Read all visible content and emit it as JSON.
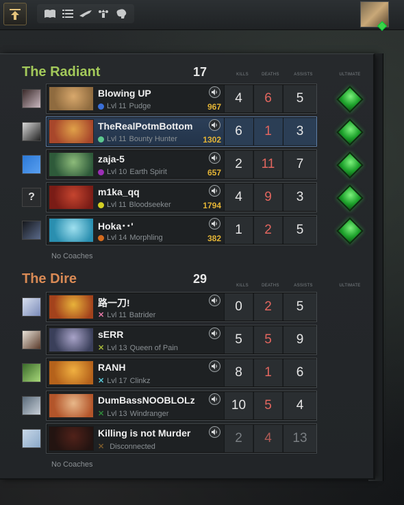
{
  "colors": {
    "radiant": "#a3c95a",
    "dire": "#d98a55",
    "deaths": "#e2665f",
    "gold": "#e3b436",
    "ultimate": "#3cd24a"
  },
  "topbar": {
    "main_button_icon": "up-arrow-icon",
    "icons": [
      "book-icon",
      "list-icon",
      "courier-icon",
      "share-icon",
      "brain-icon"
    ],
    "avatar": "player-avatar"
  },
  "columns": {
    "kills": "KILLS",
    "deaths": "DEATHS",
    "assists": "ASSISTS",
    "ultimate": "ULTIMATE"
  },
  "radiant": {
    "name": "The Radiant",
    "score": "17",
    "coaches": "No Coaches",
    "players": [
      {
        "name": "Blowing UP",
        "level": "Lvl 11",
        "hero": "Pudge",
        "gold": "967",
        "kills": "4",
        "deaths": "6",
        "assists": "5",
        "color": "#3a6fd8",
        "marker": "dot",
        "hero_colors": [
          "#8f6b3f",
          "#d8a86c"
        ],
        "pic_colors": [
          "#3a2a2a",
          "#c9b8c0"
        ],
        "pic_text": ""
      },
      {
        "name": "TheRealPotmBottom",
        "level": "Lvl 11",
        "hero": "Bounty Hunter",
        "gold": "1302",
        "kills": "6",
        "deaths": "1",
        "assists": "3",
        "color": "#5cc78f",
        "marker": "dot",
        "hero_colors": [
          "#a8472b",
          "#e0a149"
        ],
        "pic_colors": [
          "#d8d8d8",
          "#222"
        ],
        "pic_text": ""
      },
      {
        "name": "zaja-5",
        "level": "Lvl 10",
        "hero": "Earth Spirit",
        "gold": "657",
        "kills": "2",
        "deaths": "11",
        "assists": "7",
        "color": "#9b2fb5",
        "marker": "dot",
        "hero_colors": [
          "#2e5a3a",
          "#8dbb7a"
        ],
        "pic_colors": [
          "#2b78d6",
          "#5aa0f0"
        ],
        "pic_text": ""
      },
      {
        "name": "m1ka_qq",
        "level": "Lvl 11",
        "hero": "Bloodseeker",
        "gold": "1794",
        "kills": "4",
        "deaths": "9",
        "assists": "3",
        "color": "#d4cf24",
        "marker": "dot",
        "hero_colors": [
          "#7a1c16",
          "#c5452f"
        ],
        "pic_colors": [
          "#2a2c2e",
          "#2a2c2e"
        ],
        "pic_text": "?"
      },
      {
        "name": "Hoka･･'",
        "level": "Lvl 14",
        "hero": "Morphling",
        "gold": "382",
        "kills": "1",
        "deaths": "2",
        "assists": "5",
        "color": "#d46b1e",
        "marker": "dot",
        "hero_colors": [
          "#2a8fb0",
          "#9fe0ef"
        ],
        "pic_colors": [
          "#16181c",
          "#5a6a8a"
        ],
        "pic_text": ""
      }
    ]
  },
  "dire": {
    "name": "The Dire",
    "score": "29",
    "coaches": "No Coaches",
    "players": [
      {
        "name": "路一刀!",
        "level": "Lvl 11",
        "hero": "Batrider",
        "gold": "",
        "kills": "0",
        "deaths": "2",
        "assists": "5",
        "color": "#e87aa8",
        "marker": "x",
        "hero_colors": [
          "#a3421c",
          "#e8b23a"
        ],
        "pic_colors": [
          "#d8e0ef",
          "#7a8ab8"
        ],
        "pic_text": ""
      },
      {
        "name": "sERR",
        "level": "Lvl 13",
        "hero": "Queen of Pain",
        "gold": "",
        "kills": "5",
        "deaths": "5",
        "assists": "9",
        "color": "#a7b83a",
        "marker": "x",
        "hero_colors": [
          "#3a3f5a",
          "#a8a3c8"
        ],
        "pic_colors": [
          "#e8e2d8",
          "#5a3a2a"
        ],
        "pic_text": ""
      },
      {
        "name": "RANH",
        "level": "Lvl 17",
        "hero": "Clinkz",
        "gold": "",
        "kills": "8",
        "deaths": "1",
        "assists": "6",
        "color": "#5ac8d8",
        "marker": "x",
        "hero_colors": [
          "#b5621b",
          "#f0b041"
        ],
        "pic_colors": [
          "#3a6a2a",
          "#a8d87a"
        ],
        "pic_text": ""
      },
      {
        "name": "DumBassNOOBLOLz",
        "level": "Lvl 13",
        "hero": "Windranger",
        "gold": "",
        "kills": "10",
        "deaths": "5",
        "assists": "4",
        "color": "#2f8a3a",
        "marker": "x",
        "hero_colors": [
          "#b3552a",
          "#e8b88a"
        ],
        "pic_colors": [
          "#5a6a7a",
          "#c8d0d8"
        ],
        "pic_text": ""
      },
      {
        "name": "Killing is not Murder",
        "level": "",
        "hero": "Disconnected",
        "gold": "",
        "kills": "2",
        "deaths": "4",
        "assists": "13",
        "color": "#7a5a2a",
        "marker": "x",
        "hero_colors": [
          "#3a1a14",
          "#8a2a1a"
        ],
        "pic_colors": [
          "#c8d8e8",
          "#8aa8c8"
        ],
        "pic_text": "",
        "disconnected": true
      }
    ]
  }
}
